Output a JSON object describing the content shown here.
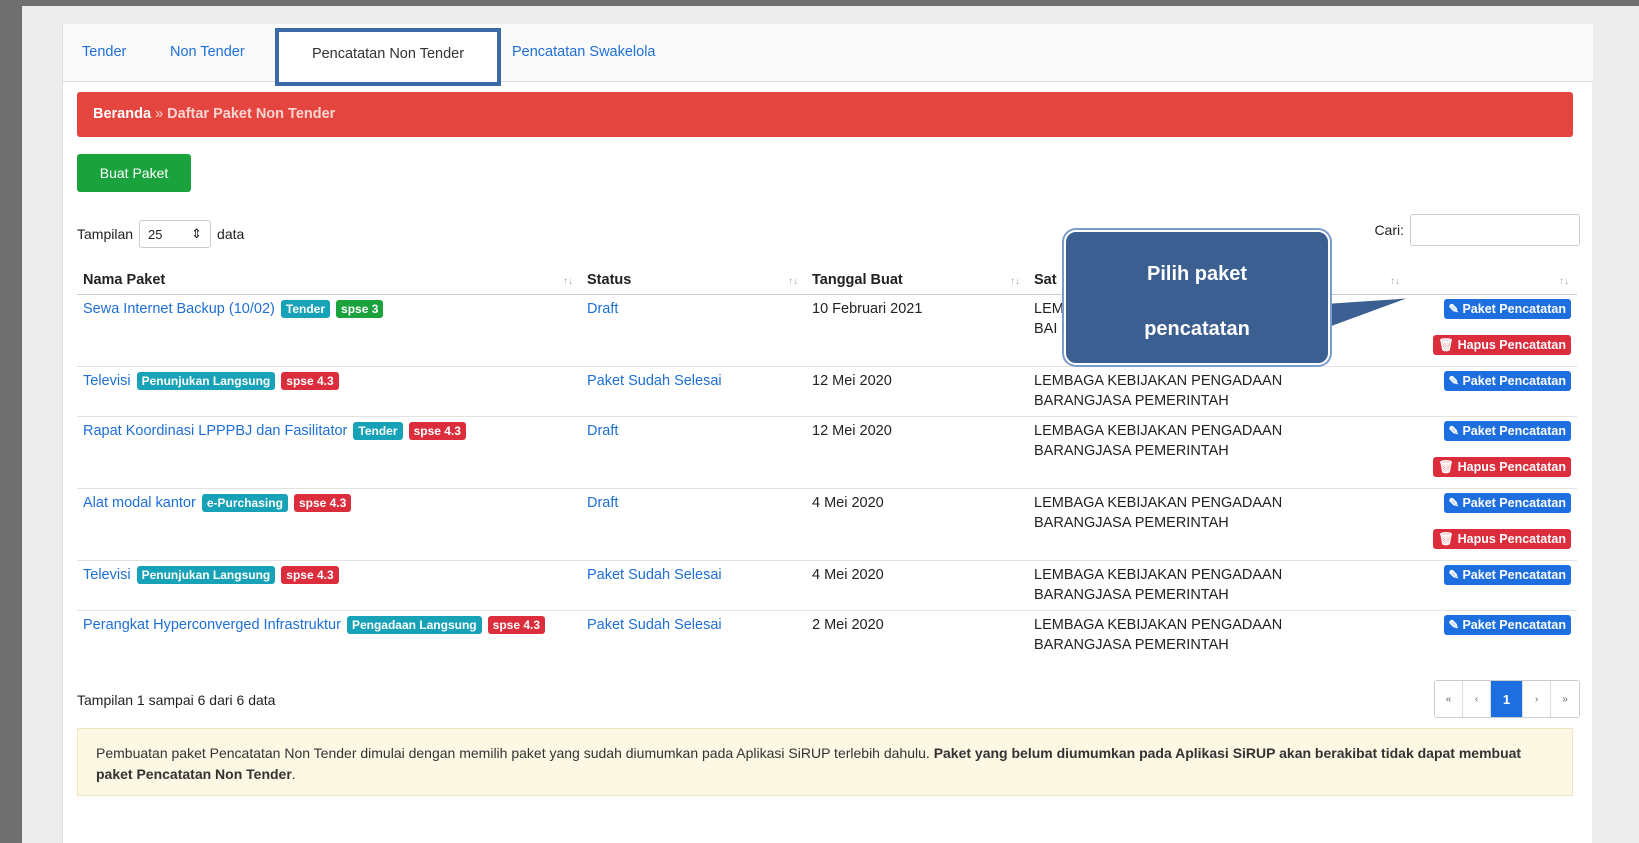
{
  "tabs": [
    "Tender",
    "Non Tender",
    "Pencatatan Non Tender",
    "Pencatatan Swakelola"
  ],
  "breadcrumb": {
    "home": "Beranda",
    "separator": "»",
    "current": "Daftar Paket Non Tender"
  },
  "create_button": "Buat Paket",
  "length": {
    "label_pre": "Tampilan",
    "value": "25",
    "label_post": "data"
  },
  "search": {
    "label": "Cari:",
    "value": ""
  },
  "table": {
    "headers": [
      "Nama Paket",
      "Status",
      "Tanggal Buat",
      "Sat"
    ],
    "rows": [
      {
        "name": "Sewa Internet Backup (10/02)",
        "badges": [
          {
            "text": "Tender",
            "color": "teal"
          },
          {
            "text": "spse 3",
            "color": "green"
          }
        ],
        "status": "Draft",
        "date": "10 Februari 2021",
        "satker": [
          "LEM",
          "BAI"
        ],
        "edit": "Paket Pencatatan",
        "delete": "Hapus Pencatatan"
      },
      {
        "name": "Televisi",
        "badges": [
          {
            "text": "Penunjukan Langsung",
            "color": "teal"
          },
          {
            "text": "spse 4.3",
            "color": "red"
          }
        ],
        "status": "Paket Sudah Selesai",
        "date": "12 Mei 2020",
        "satker": [
          "LEMBAGA KEBIJAKAN PENGADAAN",
          "BARANGJASA PEMERINTAH"
        ],
        "edit": "Paket Pencatatan",
        "delete": ""
      },
      {
        "name": "Rapat Koordinasi LPPPBJ dan Fasilitator",
        "badges": [
          {
            "text": "Tender",
            "color": "teal"
          },
          {
            "text": "spse 4.3",
            "color": "red"
          }
        ],
        "status": "Draft",
        "date": "12 Mei 2020",
        "satker": [
          "LEMBAGA KEBIJAKAN PENGADAAN",
          "BARANGJASA PEMERINTAH"
        ],
        "edit": "Paket Pencatatan",
        "delete": "Hapus Pencatatan"
      },
      {
        "name": "Alat modal kantor",
        "badges": [
          {
            "text": "e-Purchasing",
            "color": "teal"
          },
          {
            "text": "spse 4.3",
            "color": "red"
          }
        ],
        "status": "Draft",
        "date": "4 Mei 2020",
        "satker": [
          "LEMBAGA KEBIJAKAN PENGADAAN",
          "BARANGJASA PEMERINTAH"
        ],
        "edit": "Paket Pencatatan",
        "delete": "Hapus Pencatatan"
      },
      {
        "name": "Televisi",
        "badges": [
          {
            "text": "Penunjukan Langsung",
            "color": "teal"
          },
          {
            "text": "spse 4.3",
            "color": "red"
          }
        ],
        "status": "Paket Sudah Selesai",
        "date": "4 Mei 2020",
        "satker": [
          "LEMBAGA KEBIJAKAN PENGADAAN",
          "BARANGJASA PEMERINTAH"
        ],
        "edit": "Paket Pencatatan",
        "delete": ""
      },
      {
        "name": "Perangkat Hyperconverged Infrastruktur",
        "badges": [
          {
            "text": "Pengadaan Langsung",
            "color": "teal"
          },
          {
            "text": "spse 4.3",
            "color": "red"
          }
        ],
        "status": "Paket Sudah Selesai",
        "date": "2 Mei 2020",
        "satker": [
          "LEMBAGA KEBIJAKAN PENGADAAN",
          "BARANGJASA PEMERINTAH"
        ],
        "edit": "Paket Pencatatan",
        "delete": ""
      }
    ]
  },
  "info": "Tampilan 1 sampai 6 dari 6 data",
  "pagination": [
    "«",
    "‹",
    "1",
    "›",
    "»"
  ],
  "note": {
    "normal": "Pembuatan paket Pencatatan Non Tender dimulai dengan memilih paket yang sudah diumumkan pada Aplikasi SiRUP terlebih dahulu. ",
    "bold": "Paket yang belum diumumkan pada Aplikasi SiRUP akan berakibat tidak dapat membuat paket Pencatatan Non Tender",
    "end": "."
  },
  "callout": {
    "line1": "Pilih paket",
    "line2": "pencatatan"
  }
}
